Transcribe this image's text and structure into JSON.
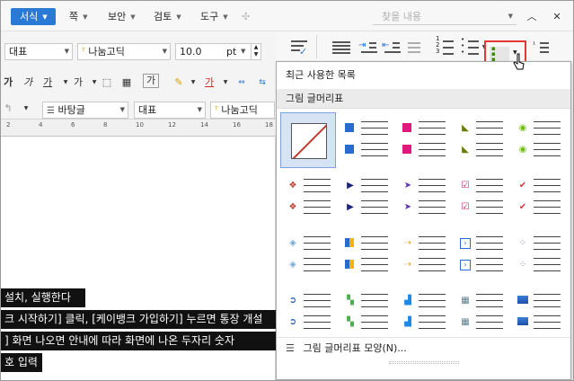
{
  "menubar": {
    "items": [
      {
        "label": "서식",
        "active": true
      },
      {
        "label": "쪽"
      },
      {
        "label": "보안"
      },
      {
        "label": "검토"
      },
      {
        "label": "도구"
      }
    ],
    "search_placeholder": "찾을 내용"
  },
  "toolbar": {
    "style_combo": "대표",
    "font_combo": "나눔고딕",
    "size_value": "10.0",
    "size_unit": "pt",
    "char_buttons": [
      "가",
      "가",
      "가",
      "가"
    ],
    "para_style_combo": "바탕글",
    "para_style2_combo": "대표",
    "font_combo2": "나눔고딕"
  },
  "document": {
    "lines": [
      "설치, 실행한다",
      "크 시작하기] 클릭, [케이뱅크 가입하기] 누르면 통장 개설",
      "] 화면 나오면 안내에 따라 화면에 나온 두자리 숫자",
      "호 입력"
    ]
  },
  "dropdown": {
    "recent_header": "최근 사용한 목록",
    "section_header": "그림 글머리표",
    "footer_label": "그림 글머리표 모양(N)...",
    "bullets": [
      [
        "none",
        "blue-square",
        "pink-square",
        "green-triangle",
        "green-circle"
      ],
      [
        "red-diamond",
        "blue-triangle",
        "purple-arrow",
        "check-pink",
        "red-check"
      ],
      [
        "blue-diamond-outline",
        "color-square",
        "orange-arrow",
        "blue-arrow-box",
        "blue-dots"
      ],
      [
        "blue-circle-arrow",
        "green-squares",
        "blue-stair",
        "grey-squares",
        "blue-bar"
      ]
    ]
  },
  "colors": {
    "accent": "#2a7ad5",
    "highlight_red": "#e53935"
  }
}
